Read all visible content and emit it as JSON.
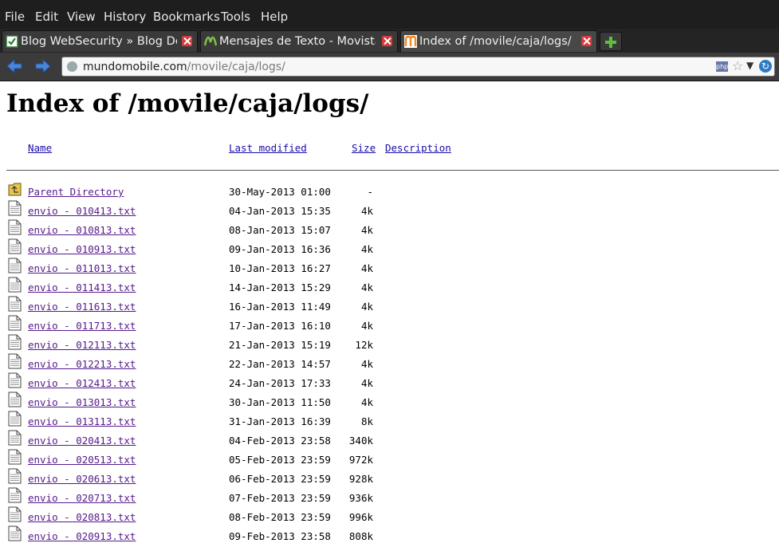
{
  "menubar": {
    "items": [
      {
        "label": "File"
      },
      {
        "label": "Edit"
      },
      {
        "label": "View"
      },
      {
        "label": "History"
      },
      {
        "label": "Bookmarks"
      },
      {
        "label": "Tools"
      },
      {
        "label": "Help"
      }
    ]
  },
  "tabs": [
    {
      "title": "Blog WebSecurity » Blog De...",
      "icon": "checkbox-favicon-icon",
      "color": "#4caf50"
    },
    {
      "title": "Mensajes de Texto - Movista...",
      "icon": "movistar-favicon-icon",
      "color": "#7bc043"
    },
    {
      "title": "Index of /movile/caja/logs/",
      "icon": "m-favicon-icon",
      "color": "#f08a24"
    }
  ],
  "urlbar": {
    "host": "mundomobile.com",
    "path": "/movile/caja/logs/",
    "badge": "php"
  },
  "page": {
    "title": "Index of /movile/caja/logs/",
    "columns": {
      "name": "Name",
      "modified": "Last modified",
      "size": "Size",
      "description": "Description"
    },
    "rows": [
      {
        "name": "Parent Directory",
        "modified": "30-May-2013 01:00",
        "size": "-",
        "type": "folder"
      },
      {
        "name": "envio - 010413.txt",
        "modified": "04-Jan-2013 15:35",
        "size": "4k",
        "type": "text"
      },
      {
        "name": "envio - 010813.txt",
        "modified": "08-Jan-2013 15:07",
        "size": "4k",
        "type": "text"
      },
      {
        "name": "envio - 010913.txt",
        "modified": "09-Jan-2013 16:36",
        "size": "4k",
        "type": "text"
      },
      {
        "name": "envio - 011013.txt",
        "modified": "10-Jan-2013 16:27",
        "size": "4k",
        "type": "text"
      },
      {
        "name": "envio - 011413.txt",
        "modified": "14-Jan-2013 15:29",
        "size": "4k",
        "type": "text"
      },
      {
        "name": "envio - 011613.txt",
        "modified": "16-Jan-2013 11:49",
        "size": "4k",
        "type": "text"
      },
      {
        "name": "envio - 011713.txt",
        "modified": "17-Jan-2013 16:10",
        "size": "4k",
        "type": "text"
      },
      {
        "name": "envio - 012113.txt",
        "modified": "21-Jan-2013 15:19",
        "size": "12k",
        "type": "text"
      },
      {
        "name": "envio - 012213.txt",
        "modified": "22-Jan-2013 14:57",
        "size": "4k",
        "type": "text"
      },
      {
        "name": "envio - 012413.txt",
        "modified": "24-Jan-2013 17:33",
        "size": "4k",
        "type": "text"
      },
      {
        "name": "envio - 013013.txt",
        "modified": "30-Jan-2013 11:50",
        "size": "4k",
        "type": "text"
      },
      {
        "name": "envio - 013113.txt",
        "modified": "31-Jan-2013 16:39",
        "size": "8k",
        "type": "text"
      },
      {
        "name": "envio - 020413.txt",
        "modified": "04-Feb-2013 23:58",
        "size": "340k",
        "type": "text"
      },
      {
        "name": "envio - 020513.txt",
        "modified": "05-Feb-2013 23:59",
        "size": "972k",
        "type": "text"
      },
      {
        "name": "envio - 020613.txt",
        "modified": "06-Feb-2013 23:59",
        "size": "928k",
        "type": "text"
      },
      {
        "name": "envio - 020713.txt",
        "modified": "07-Feb-2013 23:59",
        "size": "936k",
        "type": "text"
      },
      {
        "name": "envio - 020813.txt",
        "modified": "08-Feb-2013 23:59",
        "size": "996k",
        "type": "text"
      },
      {
        "name": "envio - 020913.txt",
        "modified": "09-Feb-2013 23:58",
        "size": "808k",
        "type": "text"
      }
    ]
  }
}
